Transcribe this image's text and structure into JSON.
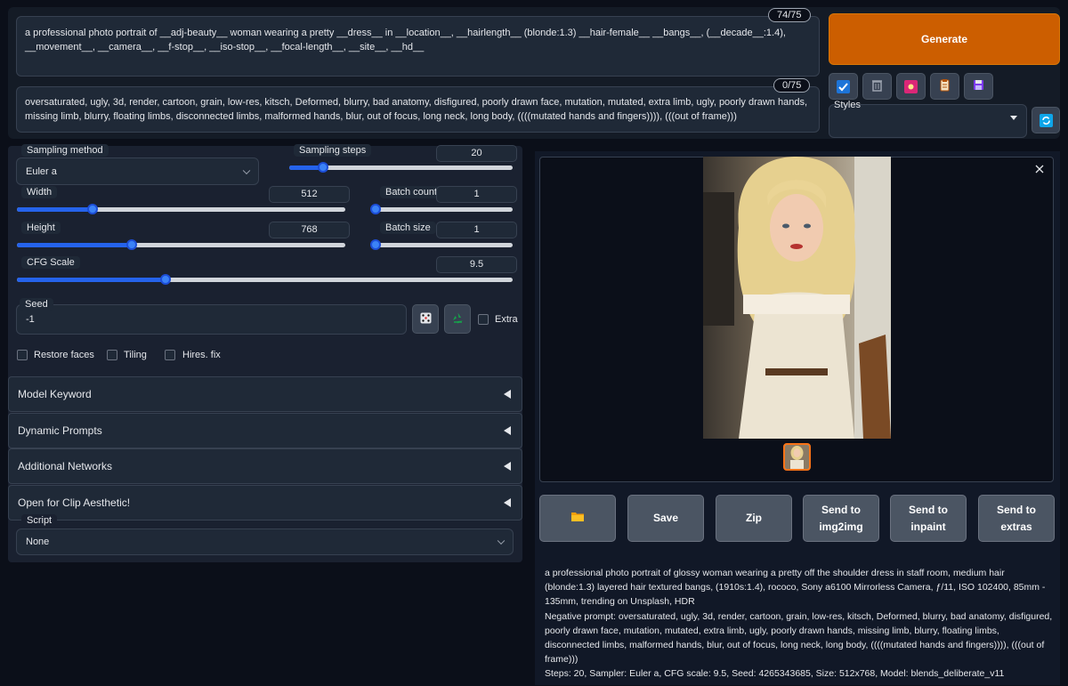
{
  "prompt": {
    "positive": "a professional photo portrait of __adj-beauty__ woman wearing a pretty __dress__ in __location__, __hairlength__ (blonde:1.3) __hair-female__ __bangs__, (__decade__:1.4), __movement__, __camera__, __f-stop__, __iso-stop__, __focal-length__, __site__, __hd__",
    "positive_count": "74/75",
    "negative": "oversaturated, ugly, 3d, render, cartoon, grain, low-res, kitsch, Deformed, blurry, bad anatomy, disfigured, poorly drawn face, mutation, mutated, extra limb, ugly, poorly drawn hands, missing limb, blurry, floating limbs, disconnected limbs, malformed hands, blur, out of focus, long neck, long body, ((((mutated hands and fingers)))), (((out of frame)))",
    "negative_count": "0/75"
  },
  "generate_label": "Generate",
  "tools": [
    {
      "icon": "check-arrow-icon",
      "color": "#1d74d8"
    },
    {
      "icon": "trash-icon",
      "color": "#9ca3af"
    },
    {
      "icon": "picture-icon",
      "color": "#ec4899"
    },
    {
      "icon": "clipboard-icon",
      "color": "#d97706"
    },
    {
      "icon": "floppy-icon",
      "color": "#7c3aed"
    }
  ],
  "styles": {
    "label": "Styles",
    "value": ""
  },
  "params": {
    "sampling_method_label": "Sampling method",
    "sampling_method_value": "Euler a",
    "sampling_steps_label": "Sampling steps",
    "sampling_steps_value": "20",
    "width_label": "Width",
    "width_value": "512",
    "height_label": "Height",
    "height_value": "768",
    "batch_count_label": "Batch count",
    "batch_count_value": "1",
    "batch_size_label": "Batch size",
    "batch_size_value": "1",
    "cfg_label": "CFG Scale",
    "cfg_value": "9.5",
    "seed_label": "Seed",
    "seed_value": "-1",
    "extra_label": "Extra"
  },
  "slider_levels": {
    "sampling_steps": 0.15,
    "width": 0.23,
    "height": 0.35,
    "batch_count": 0.0,
    "batch_size": 0.0,
    "cfg": 0.3
  },
  "checkboxes": {
    "restore_faces": "Restore faces",
    "tiling": "Tiling",
    "hires_fix": "Hires. fix"
  },
  "accordions": [
    "Model Keyword",
    "Dynamic Prompts",
    "Additional Networks",
    "Open for Clip Aesthetic!"
  ],
  "script": {
    "label": "Script",
    "value": "None"
  },
  "actions": {
    "folder_icon": "folder-icon",
    "save": "Save",
    "zip": "Zip",
    "img2img_1": "Send to",
    "img2img_2": "img2img",
    "inpaint_1": "Send to",
    "inpaint_2": "inpaint",
    "extras_1": "Send to",
    "extras_2": "extras"
  },
  "info": {
    "prompt": "a professional photo portrait of glossy woman wearing a pretty off the shoulder dress in staff room, medium hair (blonde:1.3) layered hair textured bangs, (1910s:1.4), rococo, Sony a6100 Mirrorless Camera, ƒ/11, ISO 102400, 85mm - 135mm, trending on Unsplash, HDR",
    "negative": "Negative prompt: oversaturated, ugly, 3d, render, cartoon, grain, low-res, kitsch, Deformed, blurry, bad anatomy, disfigured, poorly drawn face, mutation, mutated, extra limb, ugly, poorly drawn hands, missing limb, blurry, floating limbs, disconnected limbs, malformed hands, blur, out of focus, long neck, long body, ((((mutated hands and fingers)))), (((out of frame)))",
    "params": "Steps: 20, Sampler: Euler a, CFG scale: 9.5, Seed: 4265343685, Size: 512x768, Model: blends_deliberate_v11"
  }
}
